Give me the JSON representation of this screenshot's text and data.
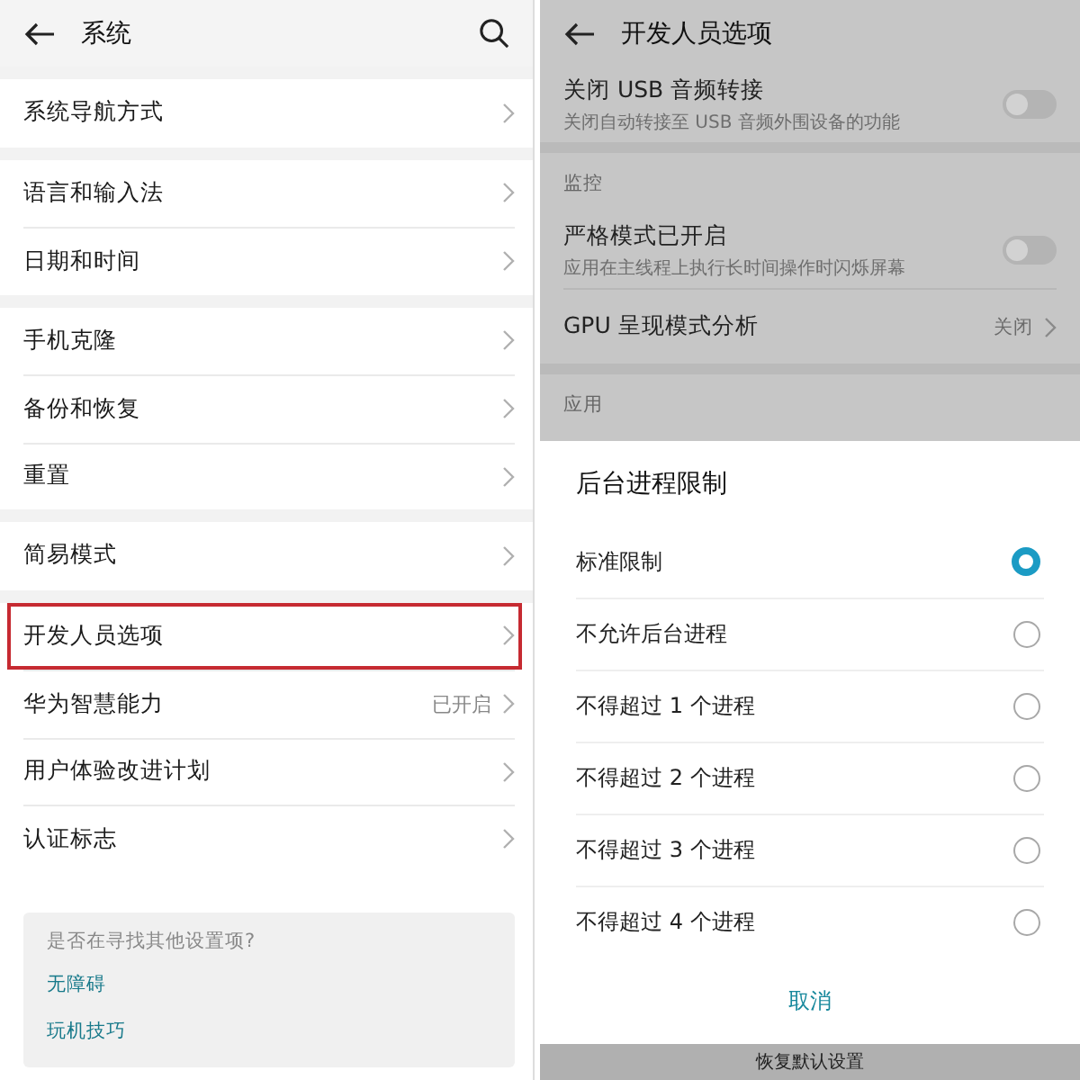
{
  "left": {
    "title": "系统",
    "groups": [
      [
        {
          "label": "系统导航方式",
          "highlighted": false
        }
      ],
      [
        {
          "label": "语言和输入法",
          "highlighted": false
        },
        {
          "label": "日期和时间",
          "highlighted": false
        }
      ],
      [
        {
          "label": "手机克隆",
          "highlighted": false
        },
        {
          "label": "备份和恢复",
          "highlighted": false
        },
        {
          "label": "重置",
          "highlighted": false
        }
      ],
      [
        {
          "label": "简易模式",
          "highlighted": false
        }
      ],
      [
        {
          "label": "开发人员选项",
          "highlighted": true
        },
        {
          "label": "华为智慧能力",
          "value": "已开启",
          "highlighted": false
        },
        {
          "label": "用户体验改进计划",
          "highlighted": false
        },
        {
          "label": "认证标志",
          "highlighted": false
        }
      ]
    ],
    "suggestions": {
      "prompt": "是否在寻找其他设置项?",
      "links": [
        "无障碍",
        "玩机技巧"
      ]
    }
  },
  "right": {
    "title": "开发人员选项",
    "sections": [
      {
        "items": [
          {
            "kind": "toggle",
            "label": "关闭 USB 音频转接",
            "description": "关闭自动转接至 USB 音频外围设备的功能",
            "on": false
          }
        ]
      },
      {
        "header": "监控",
        "items": [
          {
            "kind": "toggle",
            "label": "严格模式已开启",
            "description": "应用在主线程上执行长时间操作时闪烁屏幕",
            "on": false
          },
          {
            "kind": "link",
            "label": "GPU 呈现模式分析",
            "value": "关闭"
          }
        ]
      },
      {
        "header": "应用"
      }
    ],
    "dialog": {
      "title": "后台进程限制",
      "options": [
        {
          "label": "标准限制",
          "selected": true
        },
        {
          "label": "不允许后台进程",
          "selected": false
        },
        {
          "label": "不得超过 1 个进程",
          "selected": false
        },
        {
          "label": "不得超过 2 个进程",
          "selected": false
        },
        {
          "label": "不得超过 3 个进程",
          "selected": false
        },
        {
          "label": "不得超过 4 个进程",
          "selected": false
        }
      ],
      "cancel": "取消"
    },
    "bottom_text": "恢复默认设置"
  }
}
